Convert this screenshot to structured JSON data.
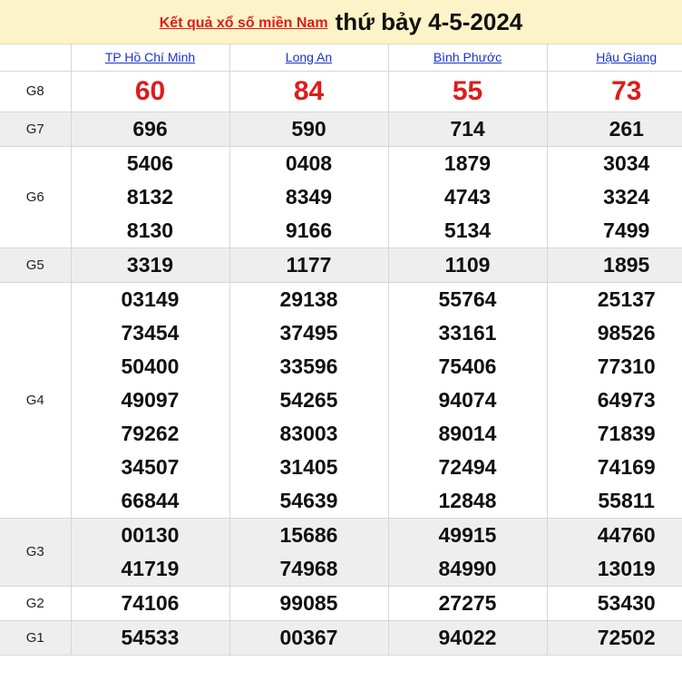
{
  "header": {
    "link_text": "Kết quả xổ số miền Nam",
    "date_text": "thứ bảy 4-5-2024"
  },
  "provinces": [
    "TP Hồ Chí Minh",
    "Long An",
    "Bình Phước",
    "Hậu Giang"
  ],
  "prizes": [
    {
      "label": "G8",
      "cols": [
        [
          "60"
        ],
        [
          "84"
        ],
        [
          "55"
        ],
        [
          "73"
        ]
      ]
    },
    {
      "label": "G7",
      "cols": [
        [
          "696"
        ],
        [
          "590"
        ],
        [
          "714"
        ],
        [
          "261"
        ]
      ]
    },
    {
      "label": "G6",
      "cols": [
        [
          "5406",
          "8132",
          "8130"
        ],
        [
          "0408",
          "8349",
          "9166"
        ],
        [
          "1879",
          "4743",
          "5134"
        ],
        [
          "3034",
          "3324",
          "7499"
        ]
      ]
    },
    {
      "label": "G5",
      "cols": [
        [
          "3319"
        ],
        [
          "1177"
        ],
        [
          "1109"
        ],
        [
          "1895"
        ]
      ]
    },
    {
      "label": "G4",
      "cols": [
        [
          "03149",
          "73454",
          "50400",
          "49097",
          "79262",
          "34507",
          "66844"
        ],
        [
          "29138",
          "37495",
          "33596",
          "54265",
          "83003",
          "31405",
          "54639"
        ],
        [
          "55764",
          "33161",
          "75406",
          "94074",
          "89014",
          "72494",
          "12848"
        ],
        [
          "25137",
          "98526",
          "77310",
          "64973",
          "71839",
          "74169",
          "55811"
        ]
      ]
    },
    {
      "label": "G3",
      "cols": [
        [
          "00130",
          "41719"
        ],
        [
          "15686",
          "74968"
        ],
        [
          "49915",
          "84990"
        ],
        [
          "44760",
          "13019"
        ]
      ]
    },
    {
      "label": "G2",
      "cols": [
        [
          "74106"
        ],
        [
          "99085"
        ],
        [
          "27275"
        ],
        [
          "53430"
        ]
      ]
    },
    {
      "label": "G1",
      "cols": [
        [
          "54533"
        ],
        [
          "00367"
        ],
        [
          "94022"
        ],
        [
          "72502"
        ]
      ]
    }
  ],
  "colors": {
    "header_bg": "#fdf3c8",
    "accent_red": "#e01b1b",
    "link_blue": "#1a33c8",
    "alt_row_bg": "#eeeeee"
  }
}
